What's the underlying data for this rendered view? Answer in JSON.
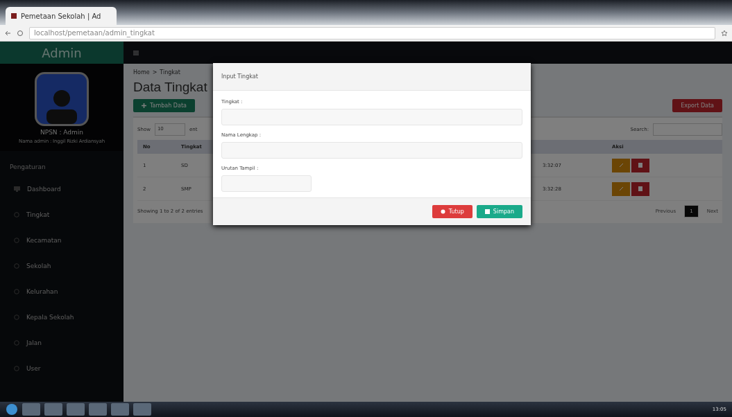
{
  "browser": {
    "tab_title": "Pemetaan Sekolah | Ad",
    "address": "localhost/pemetaan/admin_tingkat"
  },
  "sidebar": {
    "brand": "Admin",
    "user_name": "NPSN : Admin",
    "user_subtitle": "Nama admin : Inggil Rizki Ardiansyah",
    "section": "Pengaturan",
    "items": [
      {
        "label": "Dashboard",
        "kind": "dashboard"
      },
      {
        "label": "Tingkat",
        "kind": "circle"
      },
      {
        "label": "Kecamatan",
        "kind": "circle"
      },
      {
        "label": "Sekolah",
        "kind": "circle"
      },
      {
        "label": "Kelurahan",
        "kind": "circle"
      },
      {
        "label": "Kepala Sekolah",
        "kind": "circle"
      },
      {
        "label": "Jalan",
        "kind": "circle"
      },
      {
        "label": "User",
        "kind": "circle"
      }
    ]
  },
  "content": {
    "breadcrumb": [
      "Home",
      ">",
      "Tingkat"
    ],
    "title": "Data Tingkat",
    "add_button": "Tambah Data",
    "export_button": "Export Data",
    "show_label": "Show",
    "show_value": "10",
    "entries_label": "ent",
    "search_label": "Search:",
    "table": {
      "columns": [
        "No",
        "Tingkat",
        "Aksi"
      ],
      "rows": [
        {
          "no": "1",
          "tingkat": "SD",
          "time": "3:32:07"
        },
        {
          "no": "2",
          "tingkat": "SMP",
          "time": "3:32:28"
        }
      ]
    },
    "info": "Showing 1 to 2 of 2 entries",
    "pagination": {
      "previous": "Previous",
      "pages": [
        {
          "label": "1",
          "selected": true
        }
      ],
      "next": "Next"
    }
  },
  "modal": {
    "title": "Input Tingkat",
    "fields": [
      {
        "label": "Tingkat :",
        "kind": "wide"
      },
      {
        "label": "Nama Lengkap :",
        "kind": "wide"
      },
      {
        "label": "Urutan Tampil :",
        "kind": "short"
      }
    ],
    "close_button": "Tutup",
    "save_button": "Simpan"
  },
  "taskbar": {
    "clock": "13:05"
  }
}
